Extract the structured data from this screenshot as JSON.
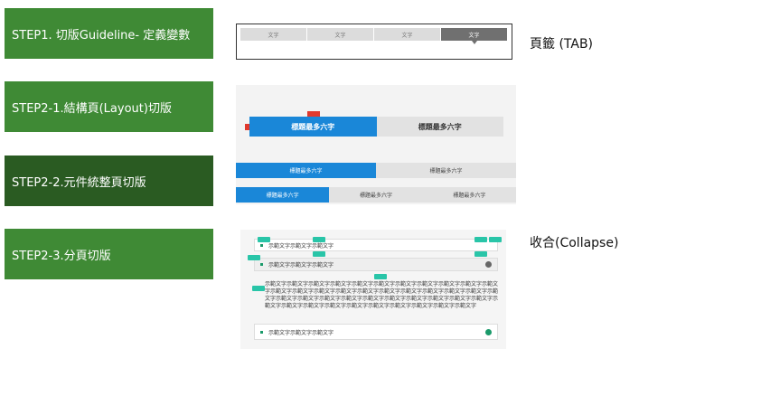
{
  "steps": [
    "STEP1. 切版Guideline- 定義變數",
    "STEP2-1.結構頁(Layout)切版",
    "STEP2-2.元件統整頁切版",
    "STEP2-3.分頁切版"
  ],
  "labels": {
    "tab": "頁籤 (TAB)",
    "collapse": "收合(Collapse)"
  },
  "tab_panel": {
    "tabs": [
      "文字",
      "文字",
      "文字",
      "文字"
    ],
    "active_index": 3
  },
  "layout_panel": {
    "big_tabs": [
      "標題最多六字",
      "標題最多六字"
    ],
    "row2": [
      "標題最多六字",
      "標題最多六字"
    ],
    "row3": [
      "標題最多六字",
      "標題最多六字",
      "標題最多六字"
    ]
  },
  "collapse_panel": {
    "item1": "示範文字示範文字示範文字",
    "item2": "示範文字示範文字示範文字",
    "body": "示範文字示範文字示範文字示範文字示範文字示範文字示範文字示範文字示範文字示範文字示範文字示範文字示範文字示範文字示範文字示範文字示範文字示範文字示範文字示範文字示範文字示範文字示範文字示範文字示範文字示範文字示範文字示範文字示範文字示範文字示範文字示範文字示範文字示範文字示範文字示範文字示範文字示範文字示範文字示範文字示範文字示範文字",
    "item3": "示範文字示範文字示範文字"
  },
  "colors": {
    "step_green": "#3f8a35",
    "step_dark_green": "#2a5b22",
    "tab_blue": "#1a87d8",
    "tag_teal": "#29c5a8"
  }
}
